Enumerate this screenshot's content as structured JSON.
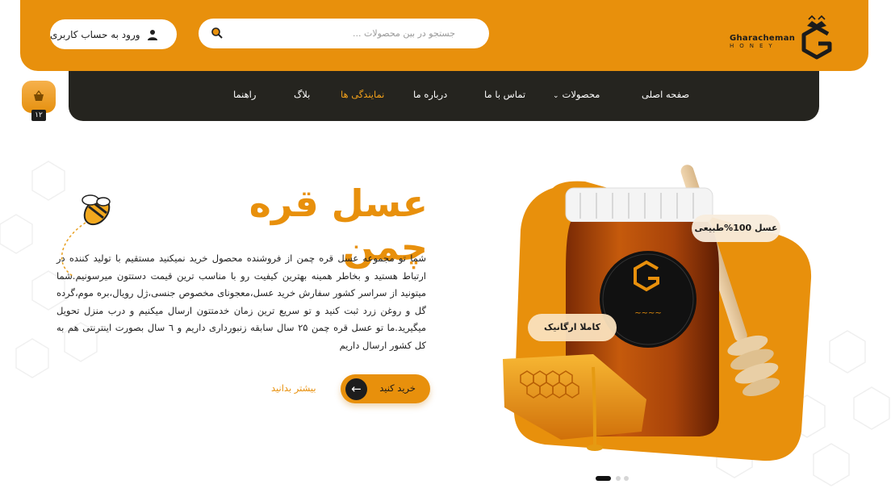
{
  "header": {
    "login_label": "ورود به حساب کاربری",
    "search_placeholder": "جستجو در بین محصولات ...",
    "brand": "Gharacheman",
    "brand_sub": "HONEY"
  },
  "nav": {
    "items": [
      {
        "label": "صفحه اصلی",
        "active": false
      },
      {
        "label": "محصولات",
        "active": false,
        "dropdown": true
      },
      {
        "label": "تماس با ما",
        "active": false
      },
      {
        "label": "درباره ما",
        "active": false
      },
      {
        "label": "نمایندگی ها",
        "active": true
      },
      {
        "label": "بلاگ",
        "active": false
      },
      {
        "label": "راهنما",
        "active": false
      }
    ]
  },
  "cart": {
    "count": "۱۲"
  },
  "hero": {
    "title": "عسل قره چمن",
    "description": "شما تو مجموعه عسل قره چمن از فروشنده محصول خرید نمیکنید مستقیم با تولید کننده در ارتباط هستید و بخاطر همینه بهترین کیفیت رو با مناسب ترین قیمت دستتون میرسونیم.شما میتونید از سراسر کشور سفارش خرید عسل،معجونای مخصوص جنسی،ژل رویال،بره موم،گرده گل و روغن زرد ثبت کنید و تو سریع ترین زمان خدمتتون ارسال میکنیم و درب منزل تحویل میگیرید.ما تو عسل قره چمن ۲۵ سال سابقه زنبورداری داریم و ٦ سال بصورت اینترنتی هم به کل کشور ارسال داریم",
    "buy_label": "خرید کنید",
    "more_label": "بیشتر بدانید",
    "badge_natural": "عسل 100%طبیعی",
    "badge_organic": "کاملا ارگانیک"
  },
  "slider": {
    "count": 3,
    "active": 0
  },
  "colors": {
    "accent": "#E8900C",
    "nav_bg": "#25241f"
  }
}
